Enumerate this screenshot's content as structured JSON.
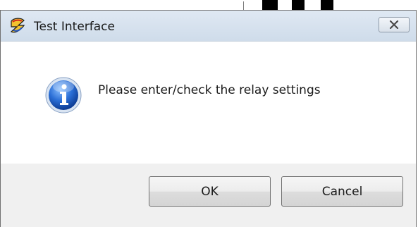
{
  "window": {
    "title": "Test Interface",
    "app_icon": "app-logo-icon",
    "close_icon": "close-icon"
  },
  "dialog": {
    "icon": "info-icon",
    "message": "Please enter/check the relay settings"
  },
  "buttons": {
    "ok_label": "OK",
    "cancel_label": "Cancel"
  },
  "colors": {
    "titlebar": "#d6e1ee",
    "content_bg": "#ffffff",
    "footer_bg": "#f0f0f0",
    "info_icon_blue": "#1d5fc7"
  }
}
